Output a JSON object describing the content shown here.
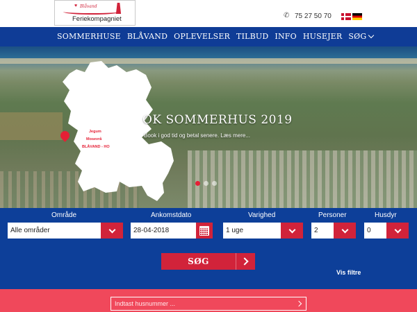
{
  "header": {
    "logo_script": "Blåvand",
    "logo_name": "Feriekompagniet",
    "phone": "75 27 50 70",
    "languages": [
      "Dansk",
      "Deutsch"
    ]
  },
  "nav": {
    "items": [
      {
        "label": "SOMMERHUSE"
      },
      {
        "label": "BLÅVAND"
      },
      {
        "label": "OPLEVELSER"
      },
      {
        "label": "TILBUD"
      },
      {
        "label": "INFO"
      },
      {
        "label": "HUSEJER"
      },
      {
        "label": "SØG"
      }
    ]
  },
  "hero": {
    "title": "OK SOMMERHUS 2019",
    "subtitle": "Book i god tid og betal senere. Læs mere...",
    "map_labels": [
      "Jegum",
      "Mosevrå",
      "BLÅVAND - HO"
    ],
    "slides_active_index": 0,
    "slides_count": 3
  },
  "search": {
    "fields": [
      {
        "label": "Område",
        "value": "Alle områder",
        "icon": "chevron-down-icon"
      },
      {
        "label": "Ankomstdato",
        "value": "28-04-2018",
        "icon": "calendar-icon"
      },
      {
        "label": "Varighed",
        "value": "1 uge",
        "icon": "chevron-down-icon"
      },
      {
        "label": "Personer",
        "value": "2",
        "icon": "chevron-down-icon"
      },
      {
        "label": "Husdyr",
        "value": "0",
        "icon": "chevron-down-icon"
      }
    ],
    "submit_label": "SØG",
    "filters_link": "Vis filtre"
  },
  "house_number": {
    "placeholder": "Indtast husnummer ..."
  },
  "colors": {
    "primary_blue": "#0d3f99",
    "accent_red": "#d1233a",
    "strip_red": "#f0485b"
  }
}
